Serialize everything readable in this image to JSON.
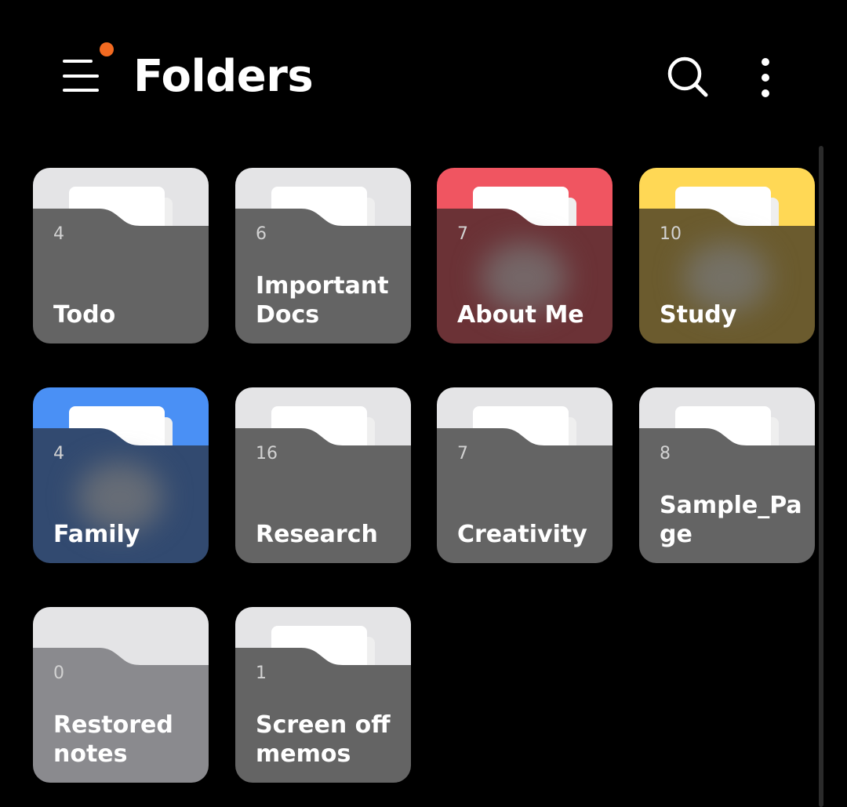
{
  "header": {
    "title": "Folders",
    "menu_icon": "hamburger-icon",
    "search_icon": "search-icon",
    "more_icon": "more-vertical-icon",
    "badge_color": "#f26a21"
  },
  "colors": {
    "background": "#000000",
    "folder_body": "#646464",
    "folder_tab_default": "#e4e4e6",
    "folder_body_muted": "#8a8a8e",
    "red_tab": "#f05561",
    "red_body": "#6b3236",
    "yellow_tab": "#ffd855",
    "yellow_body": "#6b5b2e",
    "blue_tab": "#4a90f5",
    "blue_body": "#324a70"
  },
  "folders": [
    {
      "count": "4",
      "name": "Todo",
      "tab": "#e4e4e6",
      "body": "#646464",
      "papers": true,
      "blur": false
    },
    {
      "count": "6",
      "name": "Important Docs",
      "tab": "#e4e4e6",
      "body": "#646464",
      "papers": true,
      "blur": false
    },
    {
      "count": "7",
      "name": "About Me",
      "tab": "#f05561",
      "body": "#6b3236",
      "papers": true,
      "blur": true
    },
    {
      "count": "10",
      "name": "Study",
      "tab": "#ffd855",
      "body": "#6b5b2e",
      "papers": true,
      "blur": true
    },
    {
      "count": "4",
      "name": "Family",
      "tab": "#4a90f5",
      "body": "#324a70",
      "papers": true,
      "blur": true
    },
    {
      "count": "16",
      "name": "Research",
      "tab": "#e4e4e6",
      "body": "#646464",
      "papers": true,
      "blur": false
    },
    {
      "count": "7",
      "name": "Creativity",
      "tab": "#e4e4e6",
      "body": "#646464",
      "papers": true,
      "blur": false
    },
    {
      "count": "8",
      "name": "Sample_Page",
      "tab": "#e4e4e6",
      "body": "#646464",
      "papers": true,
      "blur": false
    },
    {
      "count": "0",
      "name": "Restored notes",
      "tab": "#e4e4e6",
      "body": "#8a8a8e",
      "papers": false,
      "blur": false
    },
    {
      "count": "1",
      "name": "Screen off memos",
      "tab": "#e4e4e6",
      "body": "#646464",
      "papers": true,
      "blur": false
    }
  ]
}
